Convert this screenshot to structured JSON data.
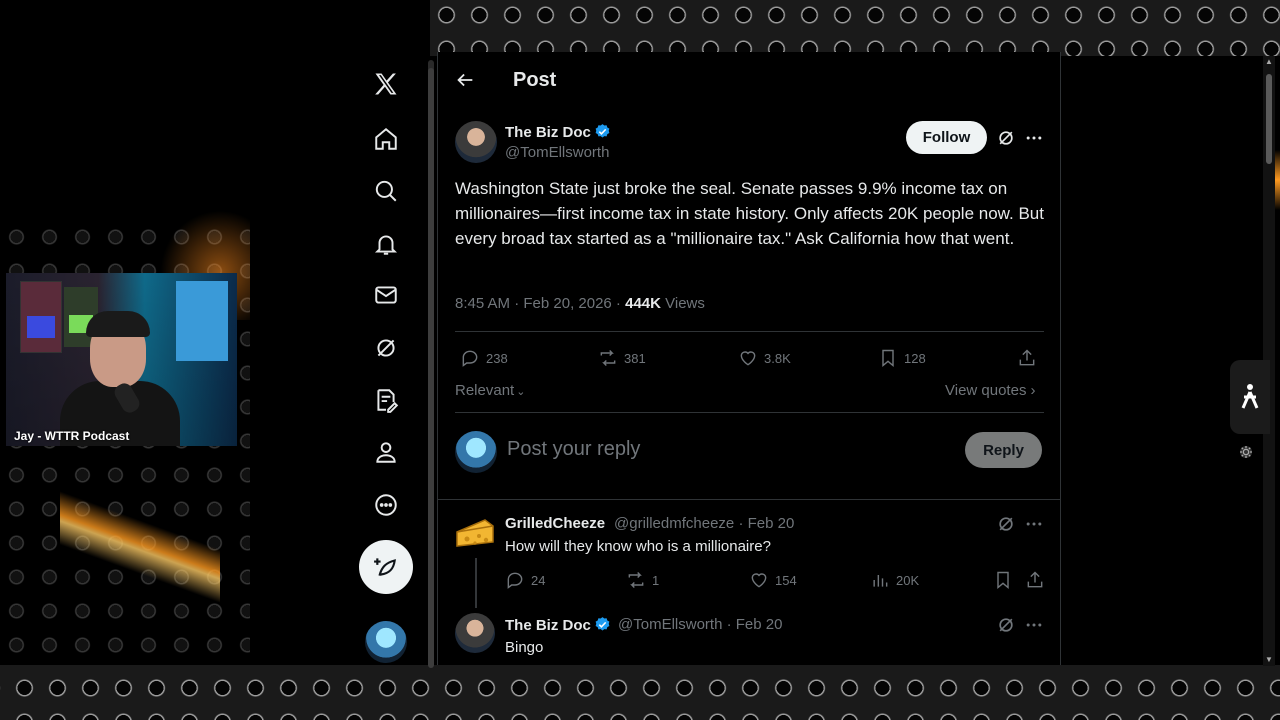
{
  "app": {
    "logo": "x-logo-icon"
  },
  "nav": {
    "items": [
      {
        "name": "home",
        "icon": "home-icon"
      },
      {
        "name": "explore",
        "icon": "search-icon"
      },
      {
        "name": "notifications",
        "icon": "bell-icon"
      },
      {
        "name": "messages",
        "icon": "mail-icon"
      },
      {
        "name": "grok",
        "icon": "grok-icon"
      },
      {
        "name": "drafts",
        "icon": "notes-icon"
      },
      {
        "name": "profile",
        "icon": "person-icon"
      },
      {
        "name": "more",
        "icon": "more-circle-icon"
      }
    ],
    "compose_icon": "feather-plus-icon"
  },
  "header": {
    "title": "Post"
  },
  "post": {
    "author_name": "The Biz Doc",
    "author_handle": "@TomEllsworth",
    "follow_label": "Follow",
    "text": "Washington State just broke the seal. Senate passes 9.9% income tax on millionaires—first income tax in state history. Only affects 20K people now. But every broad tax started as a \"millionaire tax.\" Ask California how that went.",
    "time": "8:45 AM · Feb 20, 2026 · ",
    "views_count": "444K",
    "views_label": " Views",
    "stats": {
      "replies": "238",
      "reposts": "381",
      "likes": "3.8K",
      "bookmarks": "128"
    }
  },
  "sort": {
    "label": "Relevant"
  },
  "view_quotes": "View quotes",
  "reply_box": {
    "placeholder": "Post your reply",
    "button": "Reply"
  },
  "replies": [
    {
      "name": "GrilledCheeze",
      "handle_date": "@grilledmfcheeze · Feb 20",
      "text": "How will they know who is a millionaire?",
      "stats": {
        "replies": "24",
        "reposts": "1",
        "likes": "154",
        "views": "20K"
      }
    },
    {
      "name": "The Biz Doc",
      "handle_date": "@TomEllsworth · Feb 20",
      "text": "Bingo"
    }
  ],
  "webcam": {
    "label": "Jay - WTTR Podcast"
  },
  "colors": {
    "background": "#000000",
    "text": "#e7e9ea",
    "muted": "#71767b",
    "verified": "#1d9bf0",
    "border": "#2f3336"
  }
}
